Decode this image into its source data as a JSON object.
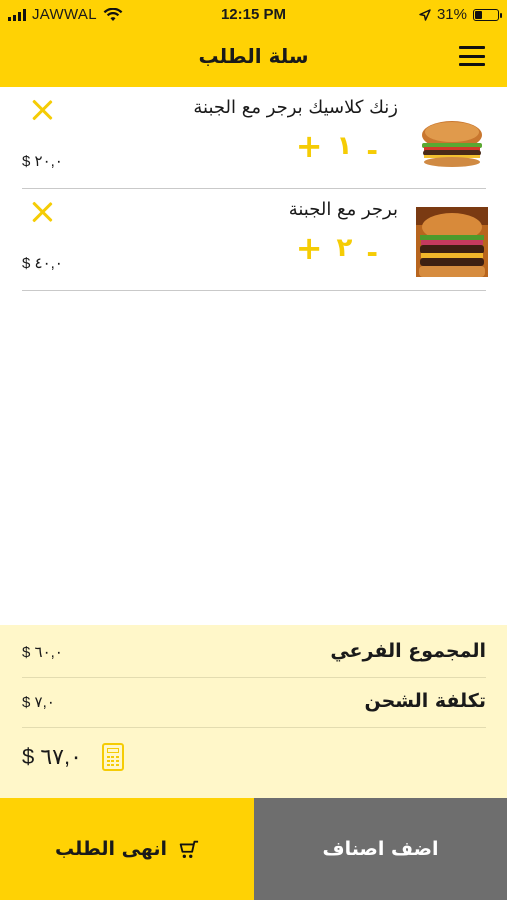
{
  "status_bar": {
    "carrier": "JAWWAL",
    "time": "12:15 PM",
    "battery": "31%",
    "battery_level": 0.31
  },
  "header": {
    "title": "سلة الطلب",
    "menu_icon": "hamburger-menu-icon"
  },
  "cart": {
    "items": [
      {
        "name": "زنك كلاسيك برجر مع الجبنة",
        "quantity": "١",
        "price": "$ ٢٠,٠",
        "image": "burger-photo"
      },
      {
        "name": "برجر مع الجبنة",
        "quantity": "٢",
        "price": "$ ٤٠,٠",
        "image": "cheeseburger-photo"
      }
    ],
    "plus_symbol": "+",
    "minus_symbol": "-"
  },
  "summary": {
    "subtotal_label": "المجموع الفرعي",
    "subtotal_value": "$ ٦٠,٠",
    "shipping_label": "تكلفة الشحن",
    "shipping_value": "$ ٧,٠",
    "total_value": "$ ٦٧,٠",
    "total_icon": "calculator-icon"
  },
  "actions": {
    "checkout_label": "انهى الطلب",
    "checkout_icon": "shopping-cart-icon",
    "add_items_label": "اضف اصناف"
  },
  "colors": {
    "accent": "#FFD204",
    "accent_text": "#F5CC05",
    "summary_bg": "#FFF7C9",
    "secondary_button": "#6E6E6E"
  }
}
